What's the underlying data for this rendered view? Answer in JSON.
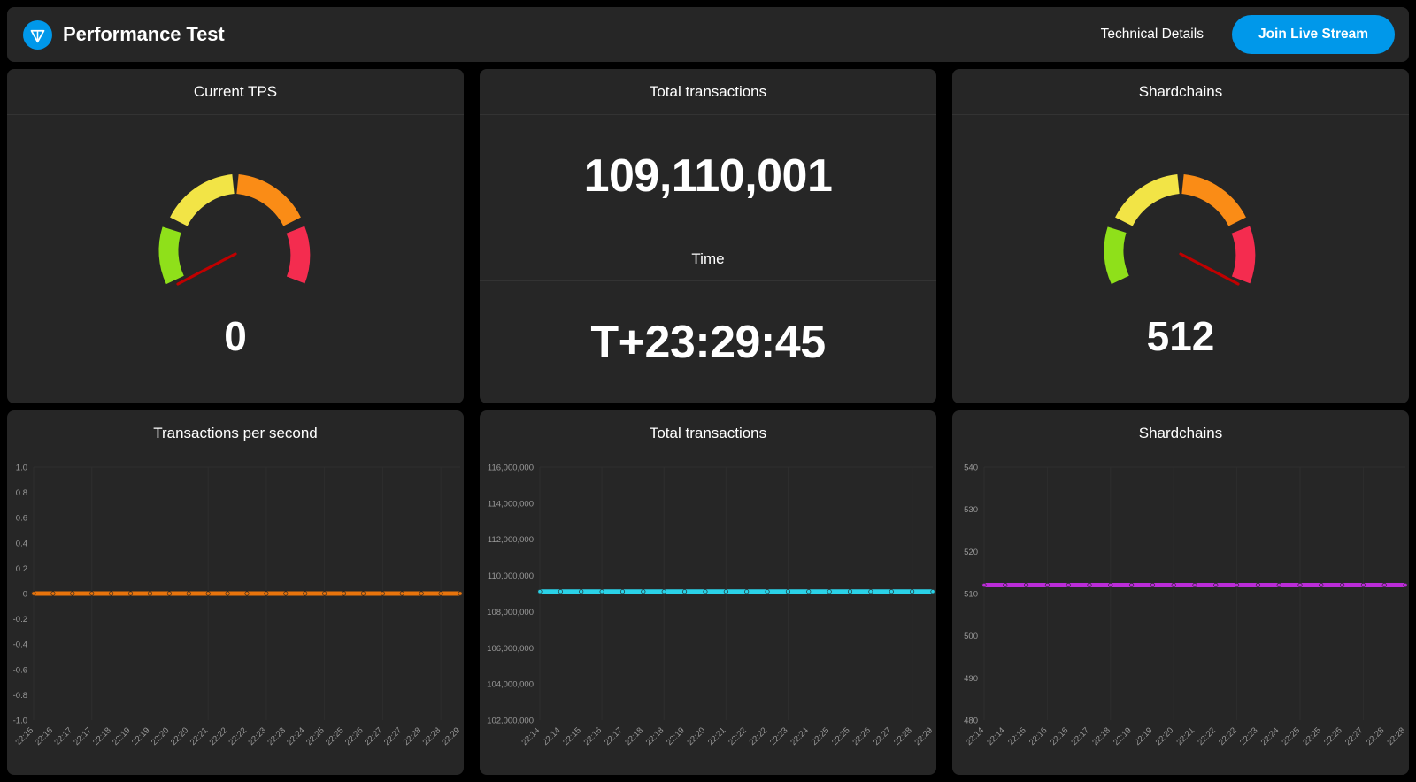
{
  "header": {
    "logo_icon": "ton-diamond-icon",
    "title": "Performance Test",
    "technical_details_label": "Technical Details",
    "join_button_label": "Join Live Stream",
    "accent_color": "#0098ea"
  },
  "top_cards": {
    "current_tps": {
      "title": "Current TPS",
      "value": "0",
      "gauge": {
        "needle_color": "#c00000",
        "segments": [
          {
            "name": "green",
            "color": "#8fe01a"
          },
          {
            "name": "yellow",
            "color": "#f2e446"
          },
          {
            "name": "orange",
            "color": "#fa8c16"
          },
          {
            "name": "red",
            "color": "#f42c4f"
          }
        ],
        "needle_fraction": 0.03
      }
    },
    "total_transactions": {
      "title": "Total transactions",
      "value": "109,110,001",
      "time_label": "Time",
      "time_value": "T+23:29:45"
    },
    "shardchains": {
      "title": "Shardchains",
      "value": "512",
      "gauge": {
        "needle_color": "#c00000",
        "segments": [
          {
            "name": "green",
            "color": "#8fe01a"
          },
          {
            "name": "yellow",
            "color": "#f2e446"
          },
          {
            "name": "orange",
            "color": "#fa8c16"
          },
          {
            "name": "red",
            "color": "#f42c4f"
          }
        ],
        "needle_fraction": 0.94
      }
    }
  },
  "chart_data": [
    {
      "type": "line",
      "title": "Transactions per second",
      "xlabel": "",
      "ylabel": "",
      "line_color": "#e8740c",
      "ylim": [
        -1.0,
        1.0
      ],
      "yticks": [
        "1.0",
        "0.8",
        "0.6",
        "0.4",
        "0.2",
        "0",
        "-0.2",
        "-0.4",
        "-0.6",
        "-0.8",
        "-1.0"
      ],
      "ytick_values": [
        1.0,
        0.8,
        0.6,
        0.4,
        0.2,
        0,
        -0.2,
        -0.4,
        -0.6,
        -0.8,
        -1.0
      ],
      "grid": true,
      "legend": "none",
      "categories": [
        "22:15",
        "22:16",
        "22:17",
        "22:17",
        "22:18",
        "22:19",
        "22:19",
        "22:20",
        "22:20",
        "22:21",
        "22:22",
        "22:22",
        "22:23",
        "22:23",
        "22:24",
        "22:25",
        "22:25",
        "22:26",
        "22:27",
        "22:27",
        "22:28",
        "22:28",
        "22:29"
      ],
      "values": [
        0,
        0,
        0,
        0,
        0,
        0,
        0,
        0,
        0,
        0,
        0,
        0,
        0,
        0,
        0,
        0,
        0,
        0,
        0,
        0,
        0,
        0,
        0
      ]
    },
    {
      "type": "line",
      "title": "Total transactions",
      "xlabel": "",
      "ylabel": "",
      "line_color": "#2ad2e8",
      "ylim": [
        102000000,
        116000000
      ],
      "yticks": [
        "116,000,000",
        "114,000,000",
        "112,000,000",
        "110,000,000",
        "108,000,000",
        "106,000,000",
        "104,000,000",
        "102,000,000"
      ],
      "ytick_values": [
        116000000,
        114000000,
        112000000,
        110000000,
        108000000,
        106000000,
        104000000,
        102000000
      ],
      "grid": true,
      "legend": "none",
      "categories": [
        "22:14",
        "22:14",
        "22:15",
        "22:16",
        "22:17",
        "22:18",
        "22:18",
        "22:19",
        "22:20",
        "22:21",
        "22:22",
        "22:22",
        "22:23",
        "22:24",
        "22:25",
        "22:25",
        "22:26",
        "22:27",
        "22:28",
        "22:29"
      ],
      "values": [
        109110001,
        109110001,
        109110001,
        109110001,
        109110001,
        109110001,
        109110001,
        109110001,
        109110001,
        109110001,
        109110001,
        109110001,
        109110001,
        109110001,
        109110001,
        109110001,
        109110001,
        109110001,
        109110001,
        109110001
      ]
    },
    {
      "type": "line",
      "title": "Shardchains",
      "xlabel": "",
      "ylabel": "",
      "line_color": "#bb2cd8",
      "ylim": [
        480,
        540
      ],
      "yticks": [
        "540",
        "530",
        "520",
        "510",
        "500",
        "490",
        "480"
      ],
      "ytick_values": [
        540,
        530,
        520,
        510,
        500,
        490,
        480
      ],
      "grid": true,
      "legend": "none",
      "categories": [
        "22:14",
        "22:14",
        "22:15",
        "22:16",
        "22:16",
        "22:17",
        "22:18",
        "22:19",
        "22:19",
        "22:20",
        "22:21",
        "22:22",
        "22:22",
        "22:23",
        "22:24",
        "22:25",
        "22:25",
        "22:26",
        "22:27",
        "22:28",
        "22:28"
      ],
      "values": [
        512,
        512,
        512,
        512,
        512,
        512,
        512,
        512,
        512,
        512,
        512,
        512,
        512,
        512,
        512,
        512,
        512,
        512,
        512,
        512,
        512
      ]
    }
  ]
}
